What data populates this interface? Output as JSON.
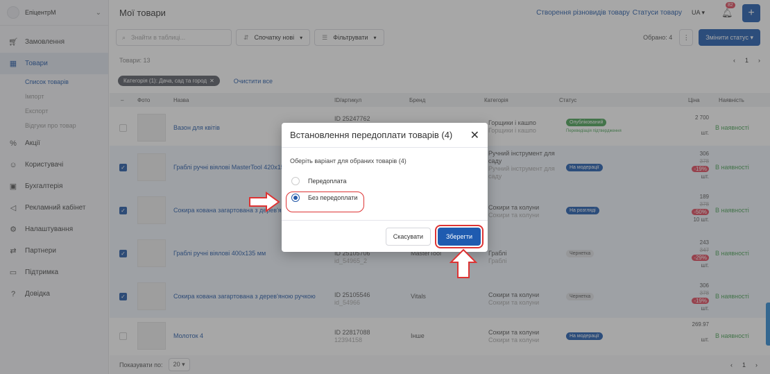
{
  "sidebar": {
    "company": "ЕпіцентрМ",
    "items": [
      {
        "label": "Замовлення",
        "icon": "cart-icon"
      },
      {
        "label": "Товари",
        "icon": "store-icon"
      },
      {
        "label": "Акції",
        "icon": "discount-icon"
      },
      {
        "label": "Користувачі",
        "icon": "users-icon"
      },
      {
        "label": "Бухгалтерія",
        "icon": "accounting-icon"
      },
      {
        "label": "Рекламний кабінет",
        "icon": "megaphone-icon"
      },
      {
        "label": "Налаштування",
        "icon": "gear-icon"
      },
      {
        "label": "Партнери",
        "icon": "handshake-icon"
      },
      {
        "label": "Підтримка",
        "icon": "chat-icon"
      },
      {
        "label": "Довідка",
        "icon": "help-icon"
      }
    ],
    "subitems": [
      "Список товарів",
      "Імпорт",
      "Експорт",
      "Відгуки про товар"
    ]
  },
  "header": {
    "title": "Мої товари",
    "link1": "Створення різновидів товару",
    "link2": "Статуси товару",
    "lang": "UA",
    "notif_count": "82"
  },
  "toolbar": {
    "search_placeholder": "Знайти в таблиці...",
    "sort_label": "Спочатку нові",
    "filter_label": "Фільтрувати",
    "selected": "Обрано: 4",
    "change_status": "Змінити статус"
  },
  "count": "Товари: 13",
  "pager": {
    "page": "1"
  },
  "filter_chip": "Категорія (1): Дача, сад та город",
  "clear_all": "Очистити все",
  "table": {
    "headers": [
      "Фото",
      "Назва",
      "ID/артикул",
      "Бренд",
      "Категорія",
      "Статус",
      "Ціна",
      "Наявність"
    ],
    "rows": [
      {
        "name": "Вазон для квітів",
        "id": "ID 25247762",
        "sku": "",
        "brand": "",
        "cat": "Горщики і кашпо",
        "cat2": "Горщики і кашпо",
        "status": "Опублікований",
        "status2": "Переведіація підтвердження",
        "price": "2 700",
        "old": "",
        "disc": "",
        "unit": "шт.",
        "avail": "В наявності"
      },
      {
        "name": "Граблі ручні віялові MasterTool 420x155",
        "id": "",
        "sku": "",
        "brand": "",
        "cat": "Ручний інструмент для саду",
        "cat2": "Ручний інструмент для саду",
        "status": "На модерації",
        "status2": "",
        "price": "306",
        "old": "378",
        "disc": "-19%",
        "unit": "шт.",
        "avail": "В наявності"
      },
      {
        "name": "Сокира кована загартована з дерев'яною ручкою",
        "id": "",
        "sku": "",
        "brand": "",
        "cat": "Сокири та колуни",
        "cat2": "Сокири та колуни",
        "status": "На розгляді",
        "status2": "",
        "price": "189",
        "old": "378",
        "disc": "-50%",
        "unit": "10 шт.",
        "avail": "В наявності"
      },
      {
        "name": "Граблі ручні віялові 400x135 мм",
        "id": "ID 25105706",
        "sku": "id_54965_2",
        "brand": "MasterTool",
        "cat": "Граблі",
        "cat2": "Граблі",
        "status": "Чернетка",
        "status2": "",
        "price": "243",
        "old": "347",
        "disc": "-29%",
        "unit": "шт.",
        "avail": "В наявності"
      },
      {
        "name": "Сокира кована загартована з дерев'яною ручкою",
        "id": "ID 25105546",
        "sku": "id_54966",
        "brand": "Vitals",
        "cat": "Сокири та колуни",
        "cat2": "Сокири та колуни",
        "status": "Чернетка",
        "status2": "",
        "price": "306",
        "old": "378",
        "disc": "-19%",
        "unit": "шт.",
        "avail": "В наявності"
      },
      {
        "name": "Молоток 4",
        "id": "ID 22817088",
        "sku": "12394158",
        "brand": "Інше",
        "cat": "Сокири та колуни",
        "cat2": "Сокири та колуни",
        "status": "На модерації",
        "status2": "",
        "price": "269.97",
        "old": "",
        "disc": "",
        "unit": "шт.",
        "avail": "В наявності"
      }
    ]
  },
  "modal": {
    "title": "Встановлення передоплати товарів (4)",
    "instruction": "Оберіть варіант для обраних товарів (4)",
    "option1": "Передоплата",
    "option2": "Без передоплати",
    "cancel": "Скасувати",
    "save": "Зберегти"
  },
  "bottom": {
    "show_label": "Показувати по:",
    "per_page": "20",
    "page": "1"
  }
}
